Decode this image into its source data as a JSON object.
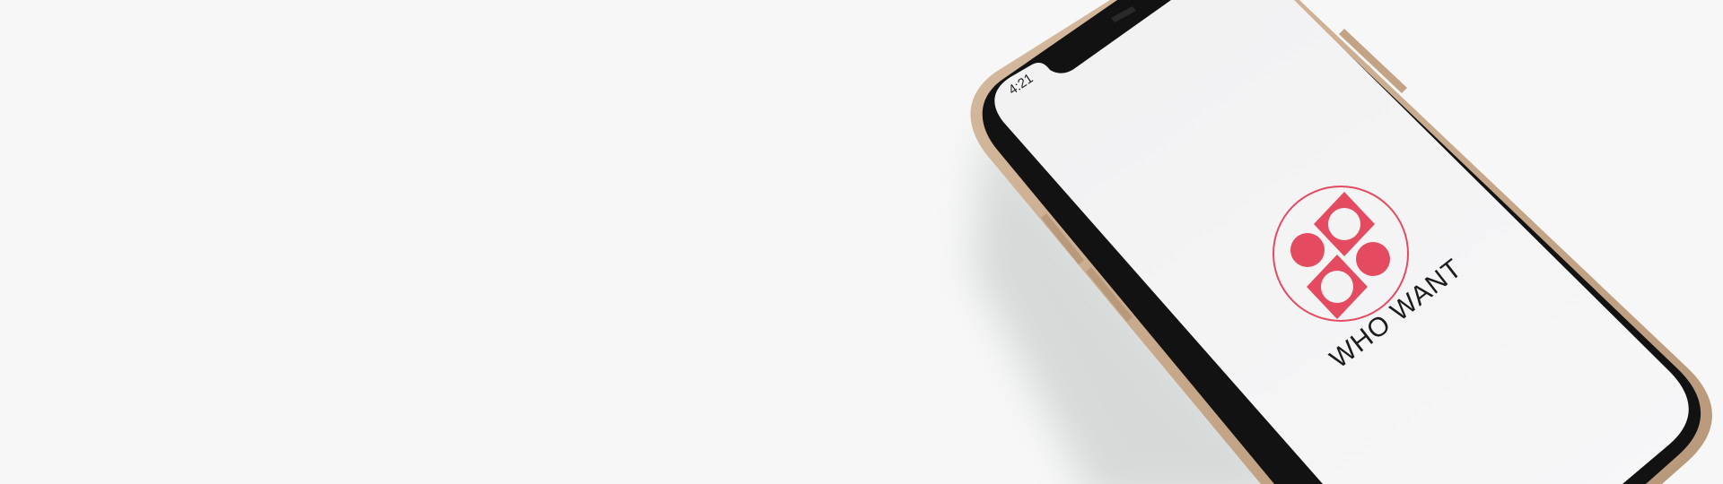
{
  "device": {
    "status_bar": {
      "time": "4:21"
    },
    "app": {
      "name": "WHO WANT",
      "logo_icon": "who-want-logo-icon"
    }
  },
  "colors": {
    "background": "#f6f7f6",
    "screen": "#f3f3f4",
    "bezel": "#111111",
    "frame": "#c9ab8f",
    "brand": "#e54b60"
  }
}
